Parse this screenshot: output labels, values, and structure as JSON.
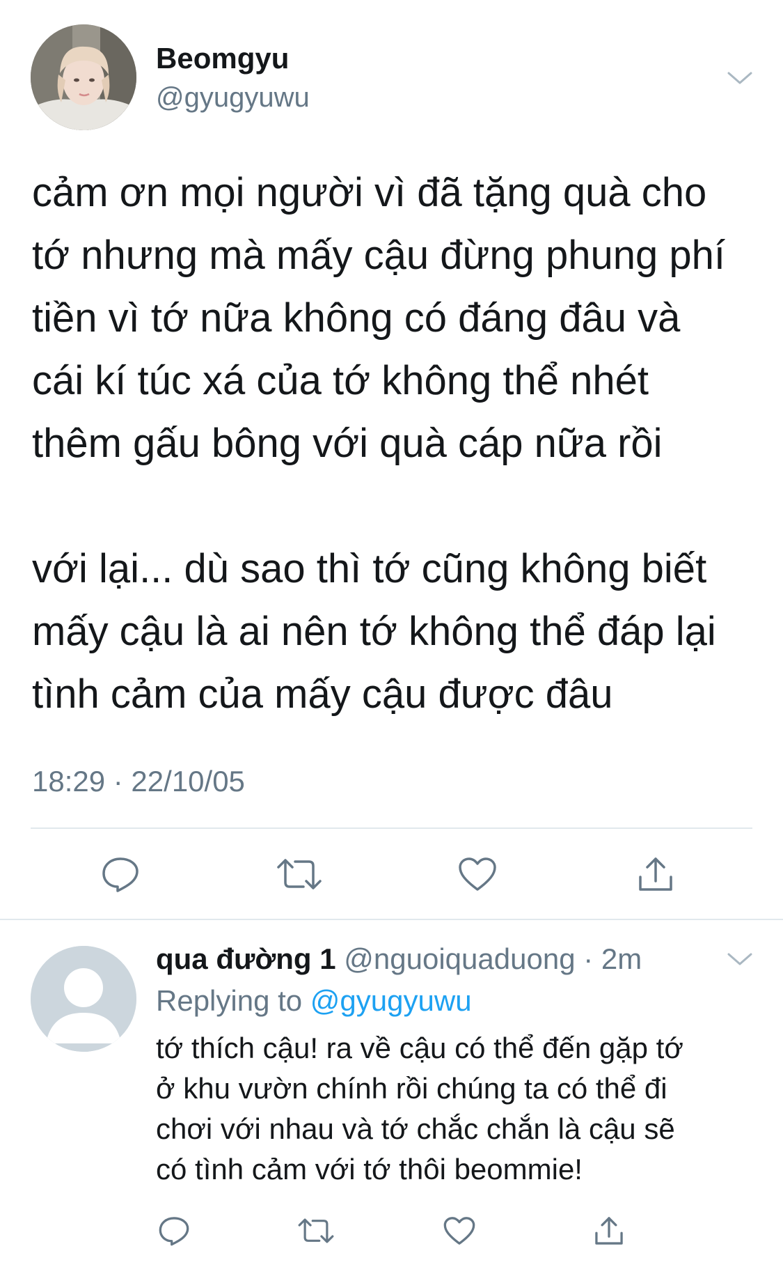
{
  "tweet": {
    "author": {
      "name": "Beomgyu",
      "handle": "@gyugyuwu"
    },
    "text_lines": [
      "cảm ơn mọi người vì đã tặng quà cho",
      "tớ nhưng mà mấy cậu đừng phung phí",
      "tiền vì tớ nữa không có đáng đâu và",
      "cái kí túc xá của tớ không thể nhét",
      "thêm gấu bông với quà cáp nữa rồi",
      "",
      "với lại... dù sao thì tớ cũng không biết",
      "mấy cậu là ai nên tớ không thể đáp lại",
      "tình cảm của mấy cậu được đâu"
    ],
    "timestamp": "18:29 · 22/10/05",
    "actions": [
      "reply-icon",
      "retweet-icon",
      "like-icon",
      "share-icon"
    ]
  },
  "reply": {
    "author": {
      "name": "qua đường 1",
      "handle": "@nguoiquaduong",
      "separator": "·",
      "time": "2m"
    },
    "replying_prefix": "Replying to",
    "replying_mention": "@gyugyuwu",
    "text_lines": [
      "tớ thích cậu! ra về cậu có thể đến gặp tớ",
      "ở khu vườn chính rồi chúng ta có thể đi",
      "chơi với nhau và tớ chắc chắn là cậu sẽ",
      "có tình cảm với tớ thôi beommie!"
    ],
    "actions": [
      "reply-icon",
      "retweet-icon",
      "like-icon",
      "share-icon"
    ]
  },
  "colors": {
    "text": "#14171a",
    "secondary": "#657786",
    "accent": "#1da1f2",
    "divider": "#e1e8ed",
    "avatar_placeholder": "#ccd6dd"
  }
}
